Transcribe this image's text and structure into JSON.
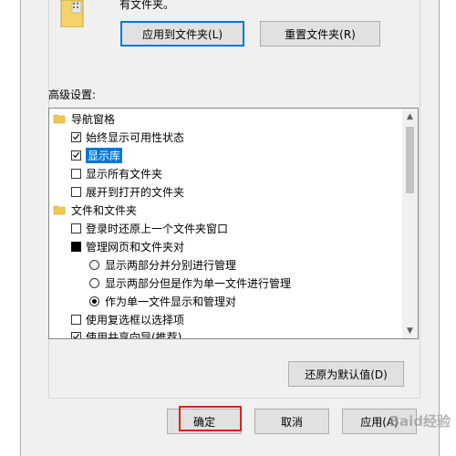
{
  "group": {
    "text": "有文件夹。",
    "apply_button": "应用到文件夹(L)",
    "reset_button": "重置文件夹(R)"
  },
  "advanced_label": "高级设置:",
  "tree": {
    "nav_pane": "导航窗格",
    "always_show_availability": "始终显示可用性状态",
    "show_libraries": "显示库",
    "show_all_folders": "显示所有文件夹",
    "expand_to_open_folder": "展开到打开的文件夹",
    "files_and_folders": "文件和文件夹",
    "restore_prev_windows": "登录时还原上一个文件夹窗口",
    "manage_pairs": "管理网页和文件夹对",
    "radio_show_both_separately": "显示两部分并分别进行管理",
    "radio_show_both_as_single": "显示两部分但是作为单一文件进行管理",
    "radio_single_file": "作为单一文件显示和管理对",
    "use_checkboxes": "使用复选框以选择项",
    "use_sharing_wizard": "使用共享向导(推荐)"
  },
  "restore_defaults_button": "还原为默认值(D)",
  "footer": {
    "ok": "确定",
    "cancel": "取消",
    "apply": "应用(A)"
  },
  "watermark": "Baid经验",
  "colors": {
    "selection": "#0078d7",
    "focus_border": "#0078d7",
    "highlight_box": "#e0201e"
  }
}
